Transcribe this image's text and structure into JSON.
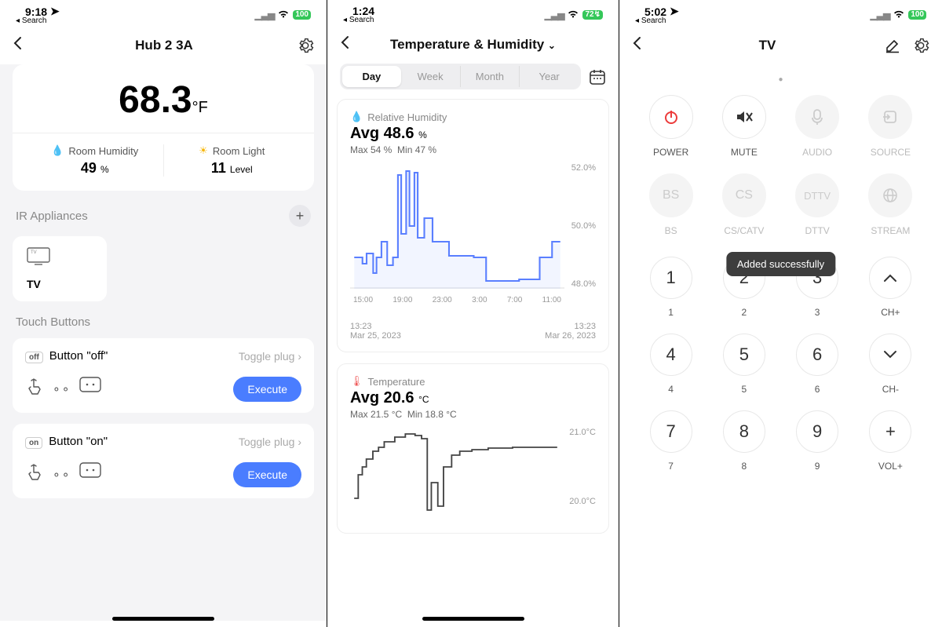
{
  "pane1": {
    "status": {
      "time": "9:18",
      "search_label": "Search",
      "battery": "100"
    },
    "nav_title": "Hub 2  3A",
    "temp_value": "68.3",
    "temp_unit": "°F",
    "humidity_label": "Room Humidity",
    "humidity_value": "49",
    "humidity_unit": "%",
    "light_label": "Room Light",
    "light_value": "11",
    "light_unit": "Level",
    "ir_header": "IR Appliances",
    "tv_label": "TV",
    "touch_header": "Touch Buttons",
    "buttons": [
      {
        "badge": "off",
        "label": "Button \"off\"",
        "action": "Toggle plug",
        "execute": "Execute"
      },
      {
        "badge": "on",
        "label": "Button \"on\"",
        "action": "Toggle plug",
        "execute": "Execute"
      }
    ]
  },
  "pane2": {
    "status": {
      "time": "1:24",
      "search_label": "Search",
      "battery": "72"
    },
    "nav_title": "Temperature & Humidity",
    "seg": [
      "Day",
      "Week",
      "Month",
      "Year"
    ],
    "humidity": {
      "title": "Relative Humidity",
      "avg_label": "Avg",
      "avg_val": "48.6",
      "avg_unit": "%",
      "max": "Max 54 %",
      "min": "Min 47 %",
      "y": [
        "52.0%",
        "50.0%",
        "48.0%"
      ],
      "x": [
        "15:00",
        "19:00",
        "23:00",
        "3:00",
        "7:00",
        "11:00"
      ],
      "from_t": "13:23",
      "from_d": "Mar 25, 2023",
      "to_t": "13:23",
      "to_d": "Mar 26, 2023"
    },
    "temperature": {
      "title": "Temperature",
      "avg_label": "Avg",
      "avg_val": "20.6",
      "avg_unit": "°C",
      "max": "Max 21.5 °C",
      "min": "Min 18.8 °C",
      "y": [
        "21.0°C",
        "20.0°C"
      ]
    }
  },
  "pane3": {
    "status": {
      "time": "5:02",
      "search_label": "Search",
      "battery": "100"
    },
    "nav_title": "TV",
    "toast": "Added successfully",
    "row1": [
      {
        "name": "power-button",
        "label": "POWER",
        "sub": "",
        "disabled": false,
        "glyph": "⏻"
      },
      {
        "name": "mute-button",
        "label": "MUTE",
        "sub": "",
        "disabled": false,
        "glyph": "🔇"
      },
      {
        "name": "audio-button",
        "label": "AUDIO",
        "sub": "",
        "disabled": true,
        "glyph": "🎙"
      },
      {
        "name": "source-button",
        "label": "SOURCE",
        "sub": "",
        "disabled": true,
        "glyph": "↪"
      }
    ],
    "row2": [
      {
        "name": "bs-button",
        "label": "BS",
        "text": "BS",
        "disabled": true
      },
      {
        "name": "cs-button",
        "label": "CS/CATV",
        "text": "CS",
        "disabled": true
      },
      {
        "name": "dttv-button",
        "label": "DTTV",
        "text": "DTTV",
        "disabled": true
      },
      {
        "name": "stream-button",
        "label": "STREAM",
        "text": "🌐",
        "disabled": true
      }
    ],
    "numpad": [
      {
        "n": "1",
        "l": "1"
      },
      {
        "n": "2",
        "l": "2"
      },
      {
        "n": "3",
        "l": "3"
      },
      {
        "n": "⌃",
        "l": "CH+"
      },
      {
        "n": "4",
        "l": "4"
      },
      {
        "n": "5",
        "l": "5"
      },
      {
        "n": "6",
        "l": "6"
      },
      {
        "n": "⌄",
        "l": "CH-"
      },
      {
        "n": "7",
        "l": "7"
      },
      {
        "n": "8",
        "l": "8"
      },
      {
        "n": "9",
        "l": "9"
      },
      {
        "n": "+",
        "l": "VOL+"
      }
    ]
  },
  "chart_data": [
    {
      "type": "line",
      "title": "Relative Humidity",
      "xlabel": "",
      "ylabel": "%",
      "ylim": [
        47,
        54
      ],
      "x_times": [
        "13:23",
        "15:00",
        "17:00",
        "19:00",
        "21:00",
        "23:00",
        "1:00",
        "3:00",
        "5:00",
        "7:00",
        "9:00",
        "11:00",
        "13:23"
      ],
      "values": [
        48,
        48,
        49,
        53,
        54,
        53,
        49,
        48,
        48,
        47,
        47,
        48,
        49
      ],
      "avg": 48.6,
      "max": 54,
      "min": 47
    },
    {
      "type": "line",
      "title": "Temperature",
      "xlabel": "",
      "ylabel": "°C",
      "ylim": [
        18.8,
        21.5
      ],
      "x_times": [
        "13:23",
        "15:00",
        "17:00",
        "19:00",
        "21:00",
        "23:00",
        "1:00",
        "3:00"
      ],
      "values": [
        19.2,
        20.4,
        21.2,
        21.5,
        21.3,
        18.8,
        19.6,
        20.6
      ],
      "avg": 20.6,
      "max": 21.5,
      "min": 18.8
    }
  ]
}
